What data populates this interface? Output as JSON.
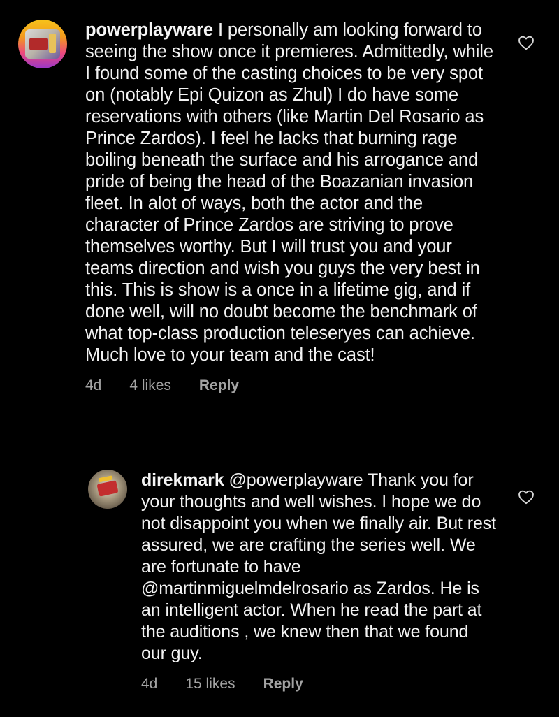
{
  "comments": [
    {
      "username": "powerplayware",
      "text": "I personally am looking forward to seeing the show once it premieres. Admittedly, while I found some of the casting choices to be very spot on (notably Epi Quizon as Zhul) I do have some reservations with others (like Martin Del Rosario as Prince Zardos). I feel he lacks that burning rage boiling beneath the surface and his arrogance and pride of being the head of the Boazanian invasion fleet. In alot of ways, both the actor and the character of Prince Zardos are striving to prove themselves worthy. But I will trust you and your teams direction and wish you guys the very best in this. This is show is a once in a lifetime gig, and if done well, will no doubt become the benchmark of what top-class production teleseryes can achieve. Much love to your team and the cast!",
      "age": "4d",
      "likes": "4 likes",
      "reply": "Reply",
      "avatar_icon": "profile-avatar"
    },
    {
      "username": "direkmark",
      "text": "@powerplayware  Thank you for your thoughts and well wishes. I hope we do not disappoint you when we finally air. But rest assured, we are crafting the series well. We are fortunate to have @martinmiguelmdelrosario as Zardos. He is an intelligent actor. When he read the part at the auditions , we knew then that we found our guy.",
      "age": "4d",
      "likes": "15 likes",
      "reply": "Reply",
      "avatar_icon": "profile-avatar"
    }
  ],
  "icons": {
    "like": "heart-outline-icon"
  },
  "colors": {
    "background": "#000000",
    "text": "#f2f2f2",
    "meta": "#a3a3a3"
  }
}
